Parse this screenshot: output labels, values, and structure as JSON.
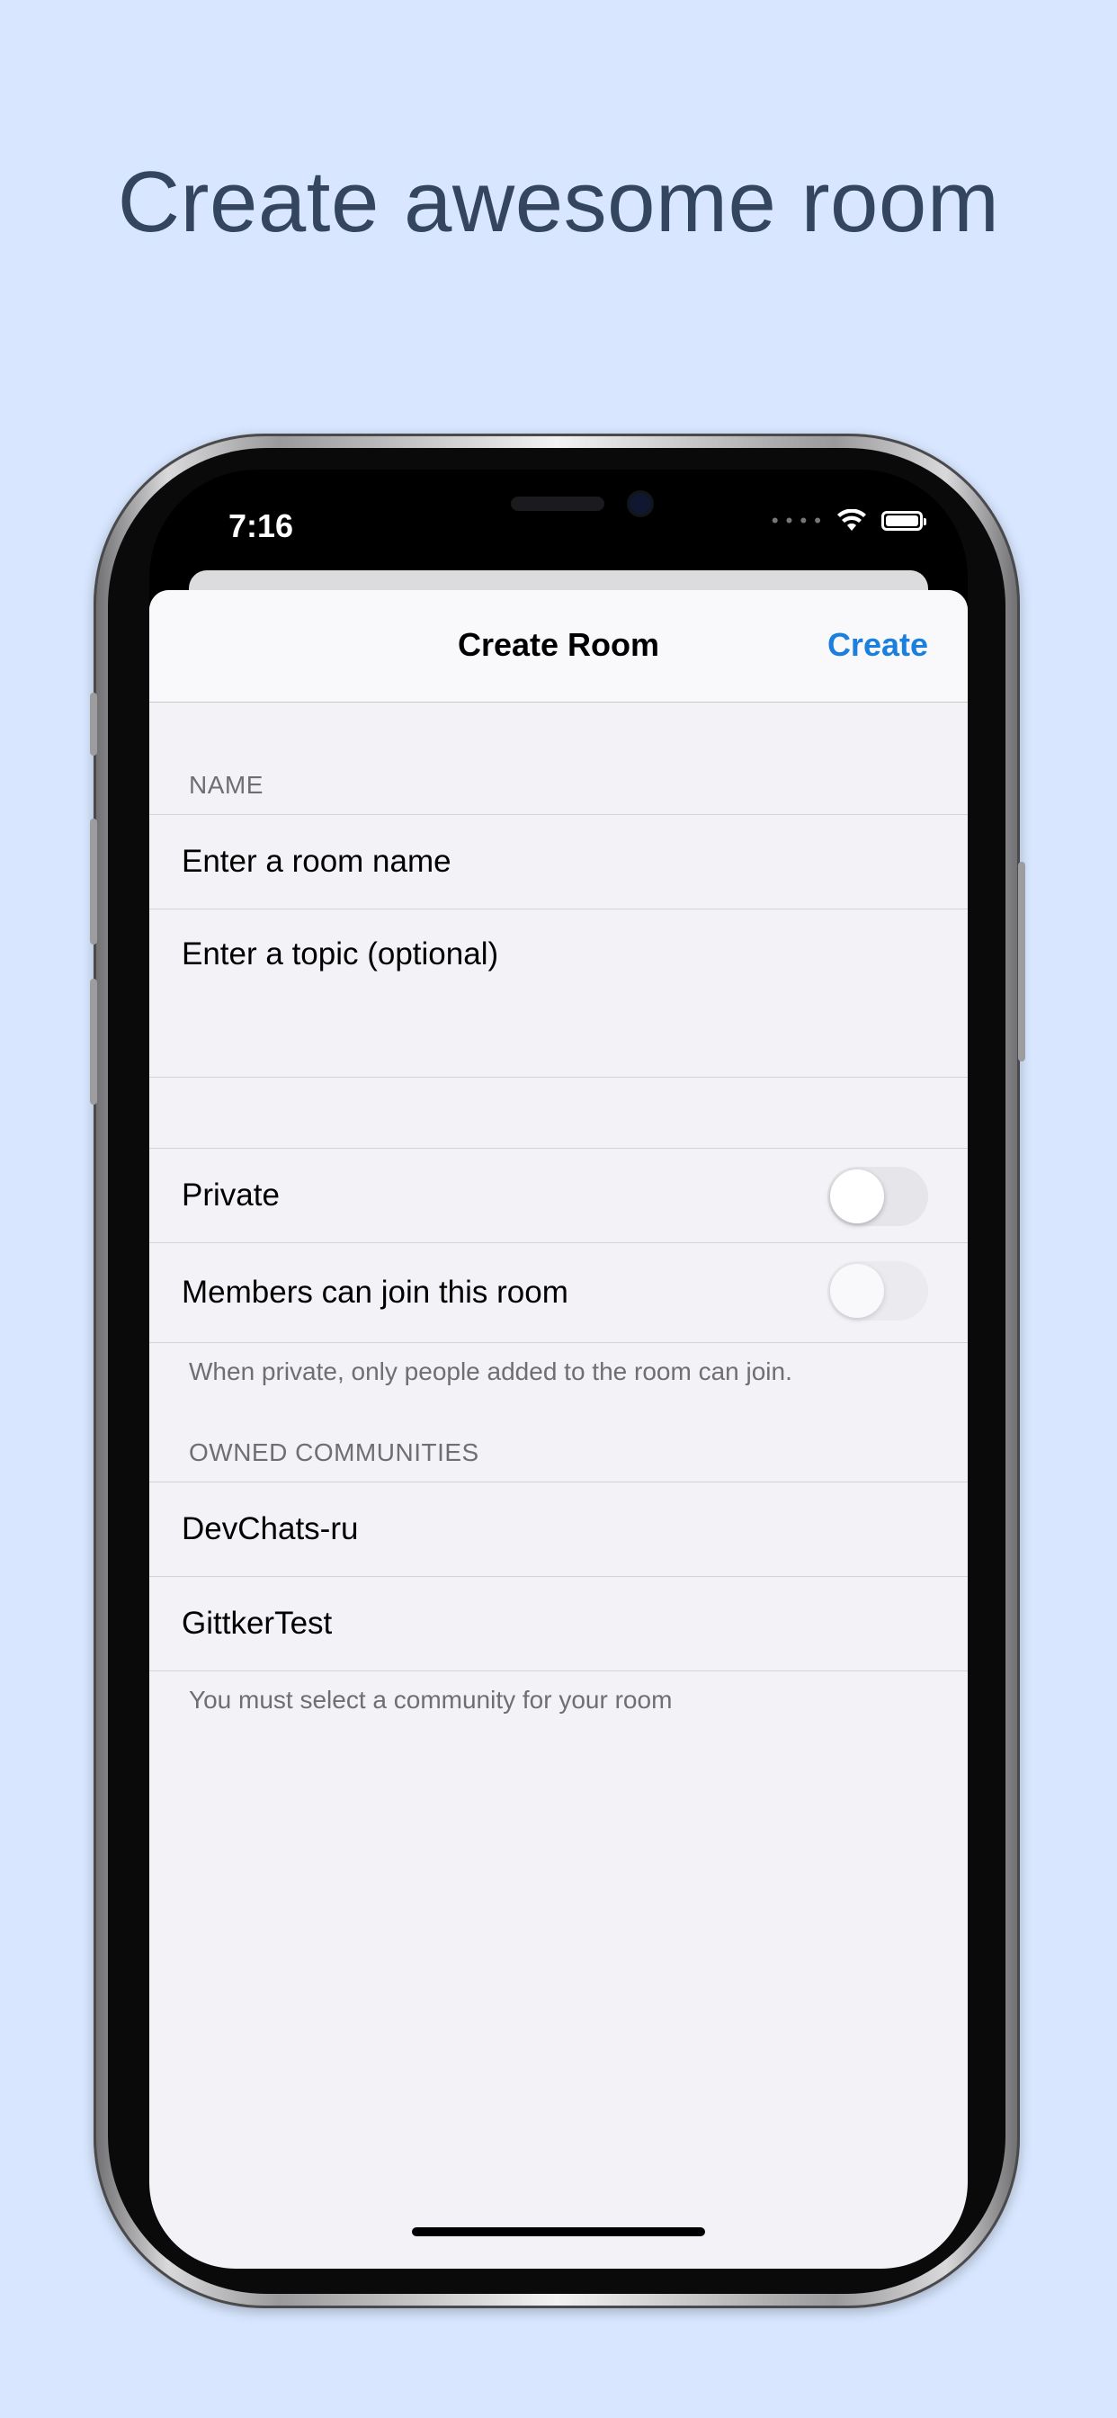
{
  "headline": "Create awesome room",
  "status_bar": {
    "time": "7:16"
  },
  "nav": {
    "title": "Create Room",
    "create_label": "Create"
  },
  "name_section": {
    "header": "NAME",
    "room_name_placeholder": "Enter a room name",
    "topic_placeholder": "Enter a topic (optional)"
  },
  "options": {
    "private_label": "Private",
    "private_on": false,
    "members_join_label": "Members can join this room",
    "members_join_on": false,
    "note": "When private, only people added to the room can join."
  },
  "communities": {
    "header": "OWNED COMMUNITIES",
    "items": [
      "DevChats-ru",
      "GittkerTest"
    ],
    "note": "You must select a community for your room"
  },
  "colors": {
    "accent": "#1a7fdd",
    "background": "#d8e7ff",
    "sheet": "#f2f2f7"
  }
}
